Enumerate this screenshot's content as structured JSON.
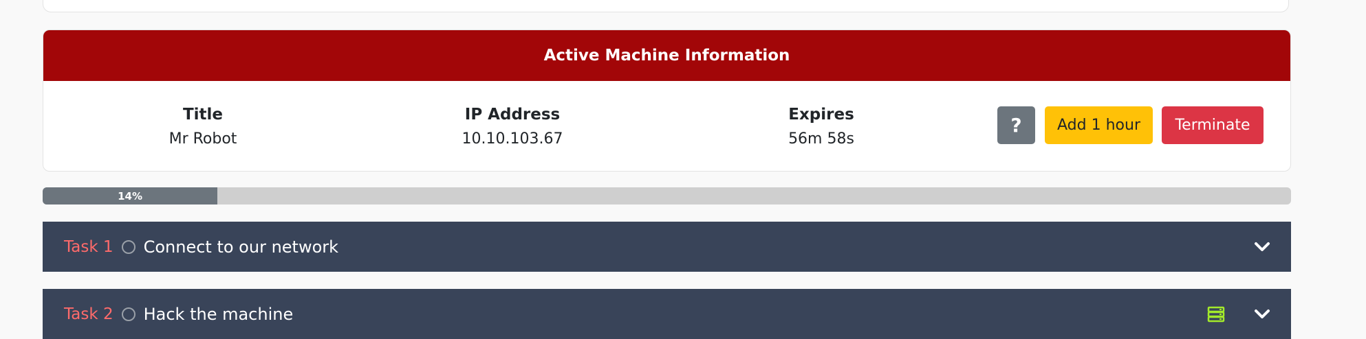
{
  "colors": {
    "header_red": "#a20608",
    "task_bg": "#394459",
    "task_number": "#ff6b6b",
    "add_button": "#ffc107",
    "terminate_button": "#dc3545",
    "server_icon": "#a3ea2a"
  },
  "machine": {
    "header": "Active Machine Information",
    "fields": [
      {
        "label": "Title",
        "value": "Mr Robot"
      },
      {
        "label": "IP Address",
        "value": "10.10.103.67"
      },
      {
        "label": "Expires",
        "value": "56m 58s"
      }
    ],
    "help_label": "?",
    "add_label": "Add 1 hour",
    "terminate_label": "Terminate"
  },
  "progress": {
    "percent": 14,
    "label": "14%"
  },
  "tasks": [
    {
      "number": "Task 1",
      "title": "Connect to our network",
      "icons": [
        "chevron-down-icon"
      ]
    },
    {
      "number": "Task 2",
      "title": "Hack the machine",
      "icons": [
        "server-icon",
        "chevron-down-icon"
      ]
    }
  ]
}
